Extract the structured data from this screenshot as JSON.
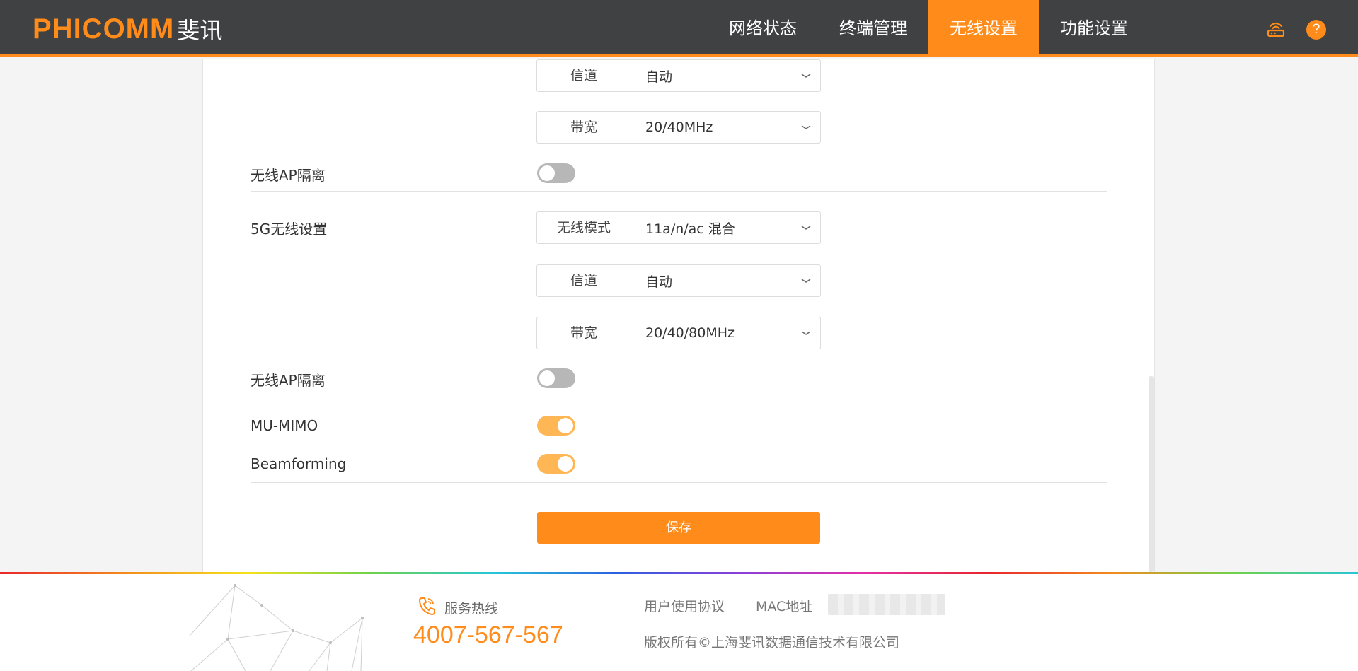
{
  "header": {
    "logo_en": "PHICOMM",
    "logo_cn": "斐讯",
    "nav": [
      {
        "label": "网络状态"
      },
      {
        "label": "终端管理"
      },
      {
        "label": "无线设置"
      },
      {
        "label": "功能设置"
      }
    ],
    "active_nav": "无线设置",
    "help_icon_text": "?"
  },
  "main": {
    "band24": {
      "channel": {
        "label": "信道",
        "value": "自动"
      },
      "bandwidth": {
        "label": "带宽",
        "value": "20/40MHz"
      },
      "ap_isolation": {
        "label": "无线AP隔离",
        "enabled": false
      }
    },
    "band5": {
      "section_label": "5G无线设置",
      "mode": {
        "label": "无线模式",
        "value": "11a/n/ac 混合"
      },
      "channel": {
        "label": "信道",
        "value": "自动"
      },
      "bandwidth": {
        "label": "带宽",
        "value": "20/40/80MHz"
      },
      "ap_isolation": {
        "label": "无线AP隔离",
        "enabled": false
      }
    },
    "mu_mimo": {
      "label": "MU-MIMO",
      "enabled": true
    },
    "beamforming": {
      "label": "Beamforming",
      "enabled": true
    },
    "save_label": "保存"
  },
  "footer": {
    "hotline_label": "服务热线",
    "hotline_number": "4007-567-567",
    "agreement_link": "用户使用协议",
    "mac_label": "MAC地址",
    "copyright": "版权所有©上海斐讯数据通信技术有限公司"
  },
  "colors": {
    "accent": "#ff8c1a",
    "header_bg": "#3f4142",
    "toggle_on": "#ffb755",
    "toggle_off": "#b7b7b7"
  }
}
